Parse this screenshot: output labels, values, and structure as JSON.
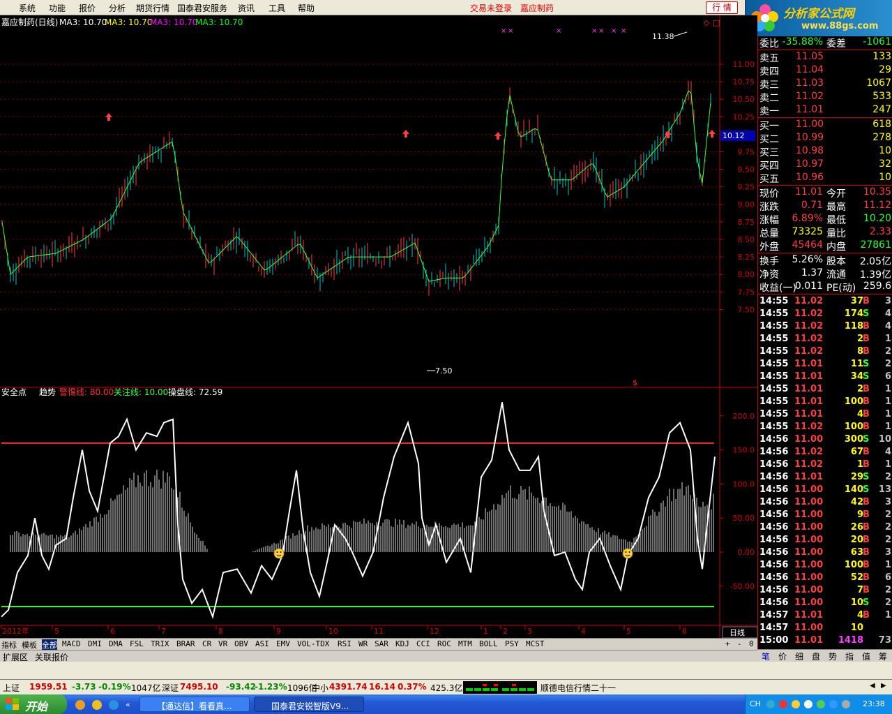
{
  "menu": {
    "items": [
      "系统",
      "功能",
      "报价",
      "分析",
      "期货行情",
      "国泰君安服务",
      "资讯",
      "工具",
      "帮助"
    ],
    "status1": "交易未登录",
    "status2": "嘉应制药",
    "quote_btn": "行 情"
  },
  "logo": {
    "line1": "分析家公式网",
    "line2": "www.88gs.com"
  },
  "main_chart": {
    "title": "嘉应制药(日线)",
    "ma": [
      "MA3: 10.70",
      "MA3: 10.70",
      "MA3: 10.70",
      "MA3: 10.70"
    ],
    "ma_colors": [
      "#ffffff",
      "#ffff00",
      "#ff00ff",
      "#00ff00"
    ],
    "yticks": [
      "11.00",
      "10.75",
      "10.50",
      "10.25",
      "10.00",
      "9.75",
      "9.50",
      "9.25",
      "9.00",
      "8.75",
      "8.50",
      "8.25",
      "8.00",
      "7.75",
      "7.50"
    ],
    "cur_price": "10.12",
    "hi_label": "11.38",
    "lo_label": "7.50"
  },
  "ind": {
    "name": "安全点",
    "trend": "趋势",
    "warn": "警惕线: 80.00",
    "focus": "关注线: 10.00",
    "op": "操盘线: 72.59",
    "yticks": [
      "200.0",
      "150.0",
      "100.0",
      "50.00",
      "0.00",
      "-50.00"
    ]
  },
  "xaxis": {
    "labels": [
      "2012年",
      "5",
      "6",
      "7",
      "8",
      "9",
      "10",
      "11",
      "12",
      "1",
      "2",
      "3",
      "4",
      "5",
      "6"
    ],
    "period": "日线"
  },
  "info": {
    "wb_label": "委比",
    "wb": "-35.88%",
    "wc_label": "委差",
    "wc": "-1061",
    "sell": [
      [
        "卖五",
        "11.05",
        "133"
      ],
      [
        "卖四",
        "11.04",
        "29"
      ],
      [
        "卖三",
        "11.03",
        "1067"
      ],
      [
        "卖二",
        "11.02",
        "533"
      ],
      [
        "卖一",
        "11.01",
        "247"
      ]
    ],
    "buy": [
      [
        "买一",
        "11.00",
        "618"
      ],
      [
        "买二",
        "10.99",
        "278"
      ],
      [
        "买三",
        "10.98",
        "10"
      ],
      [
        "买四",
        "10.97",
        "32"
      ],
      [
        "买五",
        "10.96",
        "10"
      ]
    ],
    "stats": [
      [
        "现价",
        "11.01",
        "今开",
        "10.35"
      ],
      [
        "涨跌",
        "0.71",
        "最高",
        "11.12"
      ],
      [
        "涨幅",
        "6.89%",
        "最低",
        "10.20"
      ],
      [
        "总量",
        "73325",
        "量比",
        "2.33"
      ],
      [
        "外盘",
        "45464",
        "内盘",
        "27861"
      ]
    ],
    "stats2": [
      [
        "换手",
        "5.26%",
        "股本",
        "2.05亿"
      ],
      [
        "净资",
        "1.37",
        "流通",
        "1.39亿"
      ],
      [
        "收益(一)",
        "0.011",
        "PE(动)",
        "259.6"
      ]
    ]
  },
  "ticks": [
    [
      "14:55",
      "11.02",
      "37",
      "B",
      "3"
    ],
    [
      "14:55",
      "11.02",
      "174",
      "S",
      "4"
    ],
    [
      "14:55",
      "11.02",
      "118",
      "B",
      "4"
    ],
    [
      "14:55",
      "11.02",
      "2",
      "B",
      "1"
    ],
    [
      "14:55",
      "11.02",
      "8",
      "B",
      "2"
    ],
    [
      "14:55",
      "11.01",
      "11",
      "S",
      "2"
    ],
    [
      "14:55",
      "11.01",
      "34",
      "S",
      "6"
    ],
    [
      "14:55",
      "11.01",
      "2",
      "B",
      "1"
    ],
    [
      "14:55",
      "11.01",
      "100",
      "B",
      "1"
    ],
    [
      "14:55",
      "11.01",
      "4",
      "B",
      "1"
    ],
    [
      "14:55",
      "11.02",
      "100",
      "B",
      "1"
    ],
    [
      "14:56",
      "11.00",
      "300",
      "S",
      "10"
    ],
    [
      "14:56",
      "11.02",
      "67",
      "B",
      "4"
    ],
    [
      "14:56",
      "11.02",
      "1",
      "B",
      "1"
    ],
    [
      "14:56",
      "11.01",
      "29",
      "S",
      "2"
    ],
    [
      "14:56",
      "11.00",
      "140",
      "S",
      "13"
    ],
    [
      "14:56",
      "11.00",
      "42",
      "B",
      "3"
    ],
    [
      "14:56",
      "11.00",
      "9",
      "B",
      "2"
    ],
    [
      "14:56",
      "11.00",
      "26",
      "B",
      "2"
    ],
    [
      "14:56",
      "11.00",
      "20",
      "B",
      "2"
    ],
    [
      "14:56",
      "11.00",
      "63",
      "B",
      "3"
    ],
    [
      "14:56",
      "11.00",
      "100",
      "B",
      "1"
    ],
    [
      "14:56",
      "11.00",
      "52",
      "B",
      "6"
    ],
    [
      "14:56",
      "11.00",
      "7",
      "B",
      "2"
    ],
    [
      "14:56",
      "11.00",
      "10",
      "S",
      "2"
    ],
    [
      "14:57",
      "11.01",
      "4",
      "B",
      "1"
    ],
    [
      "14:57",
      "11.00",
      "10",
      "",
      ""
    ],
    [
      "15:00",
      "11.01",
      "1418",
      "",
      "73"
    ]
  ],
  "tabs": [
    "指标",
    "模板",
    "全部",
    "MACD",
    "DMI",
    "DMA",
    "FSL",
    "TRIX",
    "BRAR",
    "CR",
    "VR",
    "OBV",
    "ASI",
    "EMV",
    "VOL-TDX",
    "RSI",
    "WR",
    "SAR",
    "KDJ",
    "CCI",
    "ROC",
    "MTM",
    "BOLL",
    "PSY",
    "MCST"
  ],
  "tabs2": [
    "扩展区",
    "关联报价"
  ],
  "rtabs": [
    "笔",
    "价",
    "细",
    "盘",
    "势",
    "指",
    "值",
    "筹"
  ],
  "status": {
    "sh_label": "上证",
    "sh": "1959.51",
    "sh_ch": "-3.73",
    "sh_pct": "-0.19%",
    "sh_amt": "1047亿",
    "sz_label": "深证",
    "sz": "7495.10",
    "sz_ch": "-93.42",
    "sz_pct": "-1.23%",
    "sz_amt": "1096亿",
    "zx_label": "中小",
    "zx": "4391.74",
    "zx_ch": "16.14",
    "zx_pct": "0.37%",
    "zx_amt": "425.3亿",
    "news": "顺德电信行情二十一"
  },
  "taskbar": {
    "start": "开始",
    "task1": "【通达信】看看真...",
    "task2": "国泰君安锐智版V9...",
    "lang": "CH",
    "time": "23:38"
  }
}
